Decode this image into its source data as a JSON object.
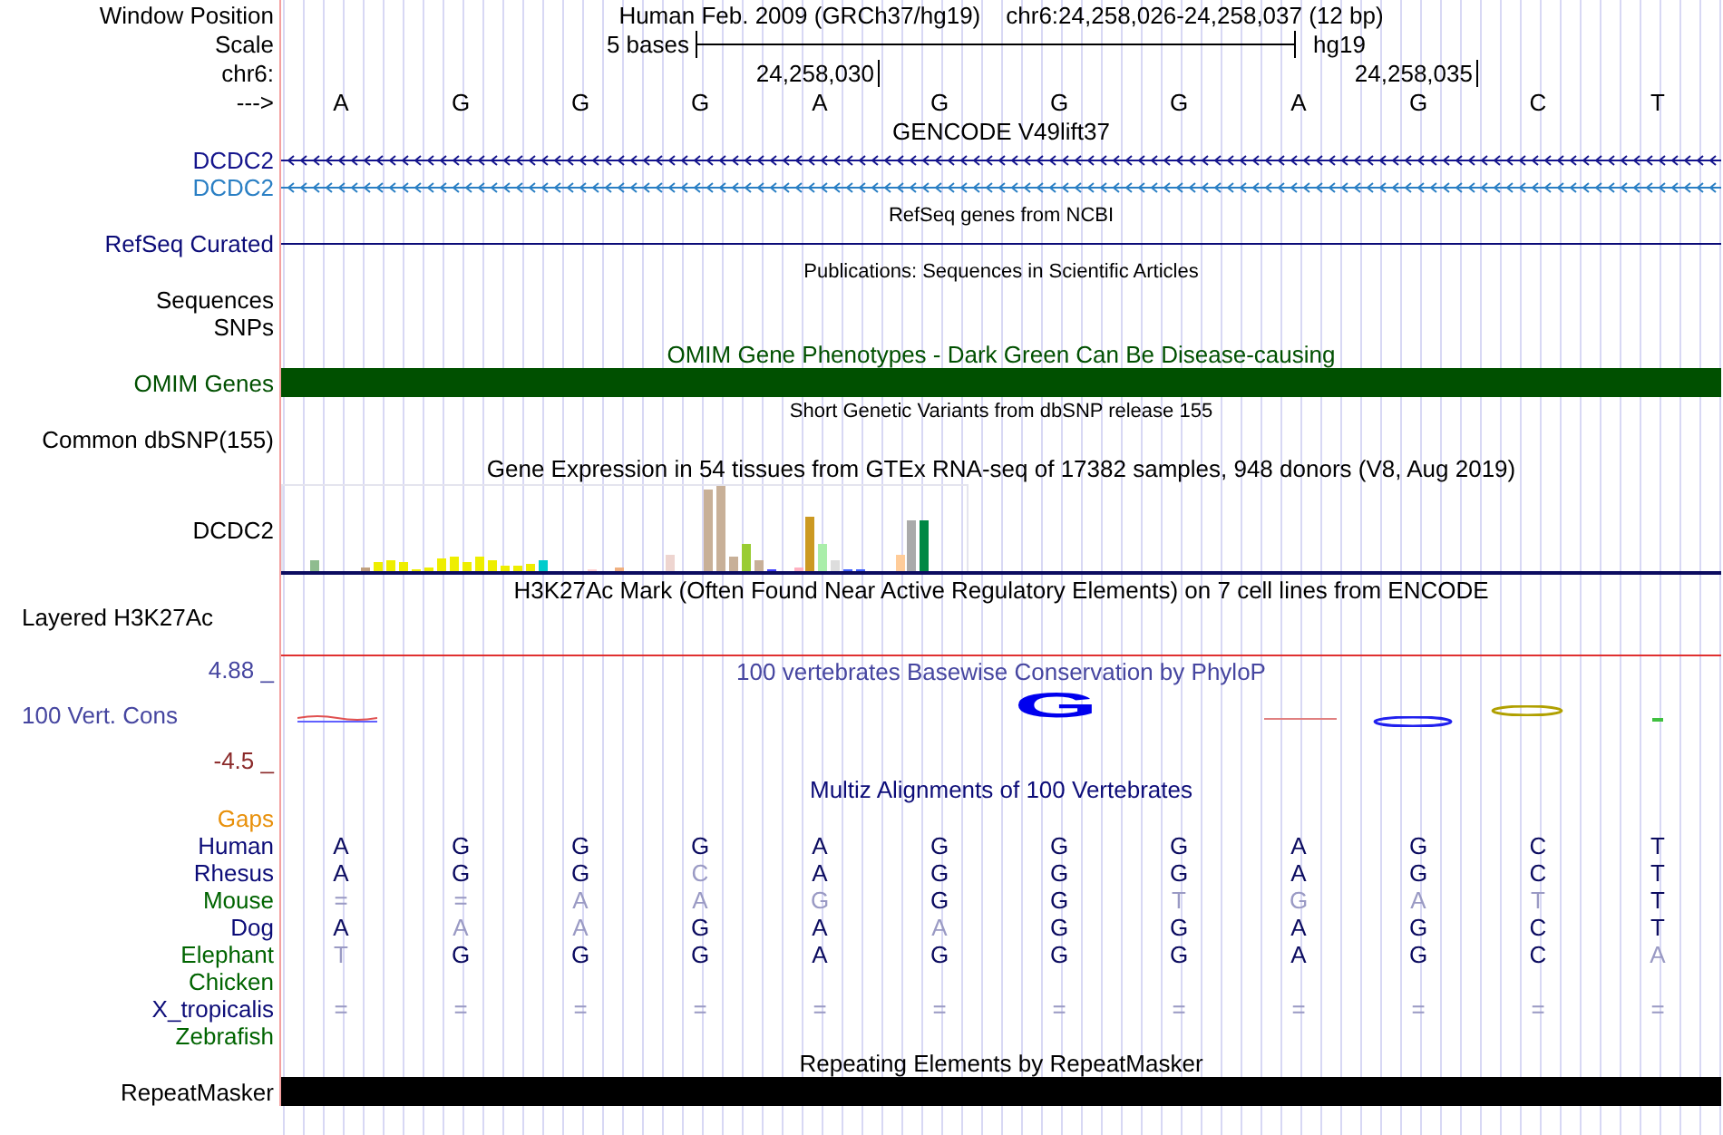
{
  "header": {
    "window_position_label": "Window Position",
    "title": "Human Feb. 2009 (GRCh37/hg19)",
    "position": "chr6:24,258,026-24,258,037 (12 bp)",
    "scale_label": "Scale",
    "scale_text": "5 bases",
    "assembly": "hg19",
    "chrom_label": "chr6:",
    "ticks": [
      "24,258,030",
      "24,258,035"
    ],
    "strand_label": "--->",
    "bases": [
      "A",
      "G",
      "G",
      "G",
      "A",
      "G",
      "G",
      "G",
      "A",
      "G",
      "C",
      "T"
    ]
  },
  "tracks": [
    {
      "kind": "gene",
      "title": "GENCODE V49lift37",
      "rows": [
        {
          "label": "DCDC2",
          "color": "#14148c"
        },
        {
          "label": "DCDC2",
          "color": "#2a7fc4"
        }
      ]
    },
    {
      "kind": "line",
      "title": "RefSeq genes from NCBI",
      "label": "RefSeq Curated",
      "color": "#0c0c78"
    },
    {
      "kind": "empty",
      "title": "Publications: Sequences in Scientific Articles",
      "labels": [
        "Sequences",
        "SNPs"
      ],
      "color": "#000000"
    },
    {
      "kind": "bar",
      "title": "OMIM Gene Phenotypes - Dark Green Can Be Disease-causing",
      "label": "OMIM Genes",
      "color": "#005000"
    },
    {
      "kind": "empty",
      "title": "Short Genetic Variants from dbSNP release 155",
      "labels": [
        "Common dbSNP(155)"
      ],
      "color": "#000000"
    },
    {
      "kind": "expression",
      "title": "Gene Expression in 54 tissues from GTEx RNA-seq of 17382 samples, 948 donors (V8, Aug 2019)",
      "label": "DCDC2"
    },
    {
      "kind": "signal",
      "title": "H3K27Ac Mark (Often Found Near Active Regulatory Elements) on 7 cell lines from ENCODE",
      "label": "Layered H3K27Ac"
    },
    {
      "kind": "conservation",
      "title": "100 vertebrates Basewise Conservation by PhyloP",
      "label": "100 Vert. Cons",
      "max": "4.88 _",
      "min": "-4.5 _",
      "logo_letter": "G",
      "color": "#4646a0"
    },
    {
      "kind": "alignment",
      "title": "Multiz Alignments of 100 Vertebrates",
      "gaps_label": "Gaps",
      "species": [
        {
          "name": "Human",
          "color": "#0c0c78",
          "bases": [
            {
              "b": "A",
              "match": true
            },
            {
              "b": "G",
              "match": true
            },
            {
              "b": "G",
              "match": true
            },
            {
              "b": "G",
              "match": true
            },
            {
              "b": "A",
              "match": true
            },
            {
              "b": "G",
              "match": true
            },
            {
              "b": "G",
              "match": true
            },
            {
              "b": "G",
              "match": true
            },
            {
              "b": "A",
              "match": true
            },
            {
              "b": "G",
              "match": true
            },
            {
              "b": "C",
              "match": true
            },
            {
              "b": "T",
              "match": true
            }
          ]
        },
        {
          "name": "Rhesus",
          "color": "#0c0c78",
          "bases": [
            {
              "b": "A",
              "match": true
            },
            {
              "b": "G",
              "match": true
            },
            {
              "b": "G",
              "match": true
            },
            {
              "b": "C",
              "match": false
            },
            {
              "b": "A",
              "match": true
            },
            {
              "b": "G",
              "match": true
            },
            {
              "b": "G",
              "match": true
            },
            {
              "b": "G",
              "match": true
            },
            {
              "b": "A",
              "match": true
            },
            {
              "b": "G",
              "match": true
            },
            {
              "b": "C",
              "match": true
            },
            {
              "b": "T",
              "match": true
            }
          ]
        },
        {
          "name": "Mouse",
          "color": "#006400",
          "bases": [
            {
              "b": "=",
              "match": false
            },
            {
              "b": "=",
              "match": false
            },
            {
              "b": "A",
              "match": false
            },
            {
              "b": "A",
              "match": false
            },
            {
              "b": "G",
              "match": false
            },
            {
              "b": "G",
              "match": true
            },
            {
              "b": "G",
              "match": true
            },
            {
              "b": "T",
              "match": false
            },
            {
              "b": "G",
              "match": false
            },
            {
              "b": "A",
              "match": false
            },
            {
              "b": "T",
              "match": false
            },
            {
              "b": "T",
              "match": true
            }
          ]
        },
        {
          "name": "Dog",
          "color": "#0c0c78",
          "bases": [
            {
              "b": "A",
              "match": true
            },
            {
              "b": "A",
              "match": false
            },
            {
              "b": "A",
              "match": false
            },
            {
              "b": "G",
              "match": true
            },
            {
              "b": "A",
              "match": true
            },
            {
              "b": "A",
              "match": false
            },
            {
              "b": "G",
              "match": true
            },
            {
              "b": "G",
              "match": true
            },
            {
              "b": "A",
              "match": true
            },
            {
              "b": "G",
              "match": true
            },
            {
              "b": "C",
              "match": true
            },
            {
              "b": "T",
              "match": true
            }
          ]
        },
        {
          "name": "Elephant",
          "color": "#006400",
          "bases": [
            {
              "b": "T",
              "match": false
            },
            {
              "b": "G",
              "match": true
            },
            {
              "b": "G",
              "match": true
            },
            {
              "b": "G",
              "match": true
            },
            {
              "b": "A",
              "match": true
            },
            {
              "b": "G",
              "match": true
            },
            {
              "b": "G",
              "match": true
            },
            {
              "b": "G",
              "match": true
            },
            {
              "b": "A",
              "match": true
            },
            {
              "b": "G",
              "match": true
            },
            {
              "b": "C",
              "match": true
            },
            {
              "b": "A",
              "match": false
            }
          ]
        },
        {
          "name": "Chicken",
          "color": "#006400"
        },
        {
          "name": "X_tropicalis",
          "color": "#0c0c78",
          "bases": [
            {
              "b": "=",
              "match": false
            },
            {
              "b": "=",
              "match": false
            },
            {
              "b": "=",
              "match": false
            },
            {
              "b": "=",
              "match": false
            },
            {
              "b": "=",
              "match": false
            },
            {
              "b": "=",
              "match": false
            },
            {
              "b": "=",
              "match": false
            },
            {
              "b": "=",
              "match": false
            },
            {
              "b": "=",
              "match": false
            },
            {
              "b": "=",
              "match": false
            },
            {
              "b": "=",
              "match": false
            },
            {
              "b": "=",
              "match": false
            }
          ]
        },
        {
          "name": "Zebrafish",
          "color": "#006400"
        }
      ]
    },
    {
      "kind": "bar",
      "title": "Repeating Elements by RepeatMasker",
      "label": "RepeatMasker",
      "color": "#000000"
    }
  ]
}
